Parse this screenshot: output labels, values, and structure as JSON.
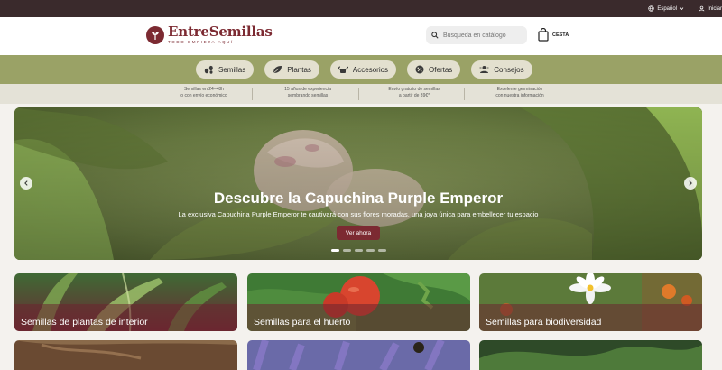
{
  "topbar": {
    "language": "Español",
    "login": "Iniciar"
  },
  "brand": {
    "name": "EntreSemillas",
    "tagline": "TODO EMPIEZA AQUÍ"
  },
  "search": {
    "placeholder": "Búsqueda en catálogo"
  },
  "cart": {
    "label": "CESTA"
  },
  "nav": {
    "items": [
      {
        "label": "Semillas",
        "icon": "seeds-icon"
      },
      {
        "label": "Plantas",
        "icon": "leaf-icon"
      },
      {
        "label": "Accesorios",
        "icon": "watering-can-icon"
      },
      {
        "label": "Ofertas",
        "icon": "discount-badge-icon"
      },
      {
        "label": "Consejos",
        "icon": "advice-icon"
      }
    ]
  },
  "features": [
    {
      "line1": "Semillas en 24–48h",
      "line2": "o con envío económico"
    },
    {
      "line1": "15 años de experiencia",
      "line2": "sembrando semillas"
    },
    {
      "line1": "Envío gratuito de semillas",
      "line2": "a partir de 39€*"
    },
    {
      "line1": "Excelente germinación",
      "line2": "con nuestra información"
    }
  ],
  "hero": {
    "title": "Descubre la Capuchina Purple Emperor",
    "subtitle": "La exclusiva Capuchina Purple Emperor te cautivará con sus flores moradas, una joya única para embellecer tu espacio",
    "cta": "Ver ahora",
    "slides_total": 5,
    "active_slide": 1
  },
  "categories": [
    {
      "label": "Semillas de plantas de interior"
    },
    {
      "label": "Semillas para el huerto"
    },
    {
      "label": "Semillas para biodiversidad"
    }
  ],
  "colors": {
    "brand": "#7c2a32",
    "nav_bg": "#9aa266",
    "topbar": "#3a2a2c"
  }
}
